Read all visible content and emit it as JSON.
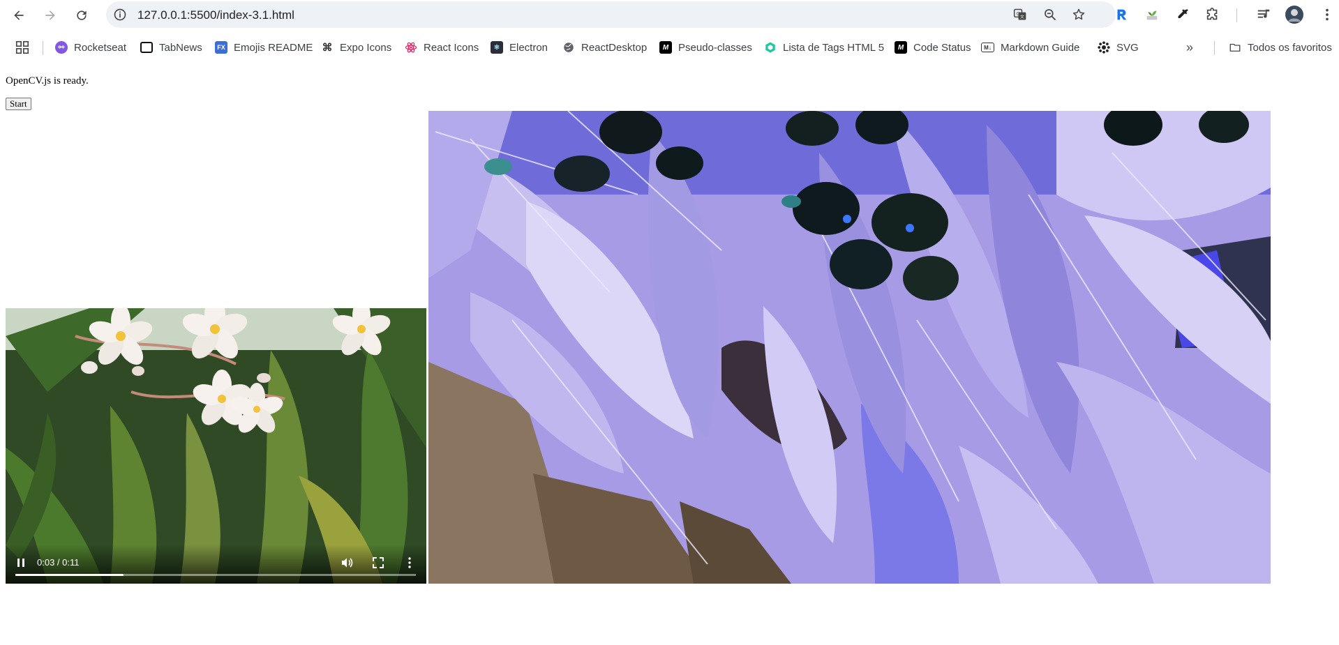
{
  "browser": {
    "url": "127.0.0.1:5500/index-3.1.html",
    "bookmarks": [
      {
        "label": "Rocketseat",
        "icon": "rocketseat-icon",
        "color": "#8257e5"
      },
      {
        "label": "TabNews",
        "icon": "tabnews-icon",
        "color": "#000000"
      },
      {
        "label": "Emojis README",
        "icon": "fx-icon",
        "color": "#3b6fd6"
      },
      {
        "label": "Expo Icons",
        "icon": "expo-icon",
        "color": "#333333"
      },
      {
        "label": "React Icons",
        "icon": "react-icon",
        "color": "#e91e63"
      },
      {
        "label": "Electron",
        "icon": "electron-icon",
        "color": "#2b2e3a"
      },
      {
        "label": "ReactDesktop",
        "icon": "globe-icon",
        "color": "#5f6368"
      },
      {
        "label": "Pseudo-classes",
        "icon": "mdn-icon",
        "color": "#000000"
      },
      {
        "label": "Lista de Tags HTML 5",
        "icon": "hexagon-icon",
        "color": "#1ec8a5"
      },
      {
        "label": "Code Status",
        "icon": "mdn-icon",
        "color": "#000000"
      },
      {
        "label": "Markdown Guide",
        "icon": "markdown-icon",
        "color": "#333333"
      },
      {
        "label": "SVG",
        "icon": "svg-icon",
        "color": "#222222"
      }
    ],
    "all_bookmarks_label": "Todos os favoritos",
    "accent_color": "#1a73e8"
  },
  "page": {
    "status_text": "OpenCV.js is ready.",
    "start_label": "Start"
  },
  "video": {
    "time": "0:03 / 0:11",
    "progress": 0.27,
    "state": "playing"
  }
}
